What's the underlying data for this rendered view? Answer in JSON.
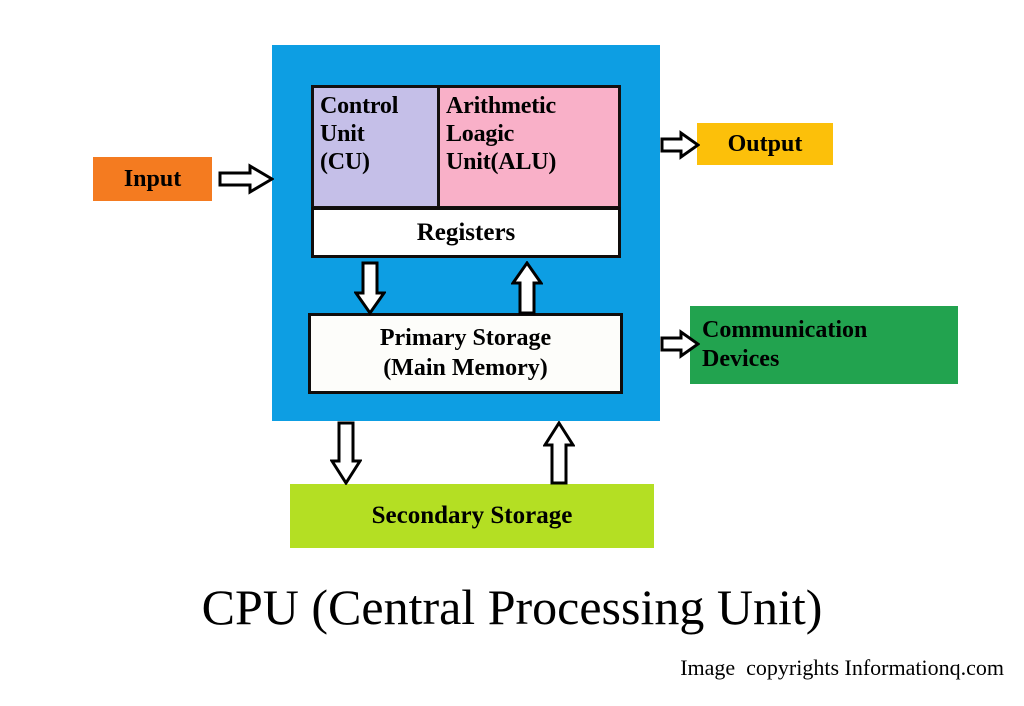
{
  "diagram": {
    "title": "CPU (Central Processing Unit)",
    "credit": "Image  copyrights Informationq.com",
    "cpu_container": {
      "name": "CPU",
      "color": "#0d9ee3"
    },
    "units": {
      "control_unit": {
        "line1": "Control",
        "line2": "Unit",
        "line3": "(CU)",
        "color": "#c5bfe8"
      },
      "alu": {
        "line1": "Arithmetic",
        "line2": "Loagic",
        "line3": "Unit(ALU)",
        "color": "#f9b0c8"
      },
      "registers": {
        "label": "Registers",
        "color": "#ffffff"
      },
      "primary_storage": {
        "line1": "Primary Storage",
        "line2": "(Main Memory)",
        "color": "#fdfdfa"
      }
    },
    "peripherals": {
      "input": {
        "label": "Input",
        "color": "#f47b20"
      },
      "output": {
        "label": "Output",
        "color": "#fcc00a"
      },
      "communication": {
        "line1": "Communication",
        "line2": "Devices",
        "color": "#22a34f"
      },
      "secondary_storage": {
        "label": "Secondary Storage",
        "color": "#b4df23"
      }
    },
    "arrows": {
      "input_to_cpu": "arrow-right",
      "cpu_to_output": "arrow-right",
      "cpu_to_communication": "arrow-right",
      "registers_to_primary": "arrow-down",
      "primary_to_registers": "arrow-up",
      "cpu_to_secondary": "arrow-down",
      "secondary_to_cpu": "arrow-up"
    }
  }
}
